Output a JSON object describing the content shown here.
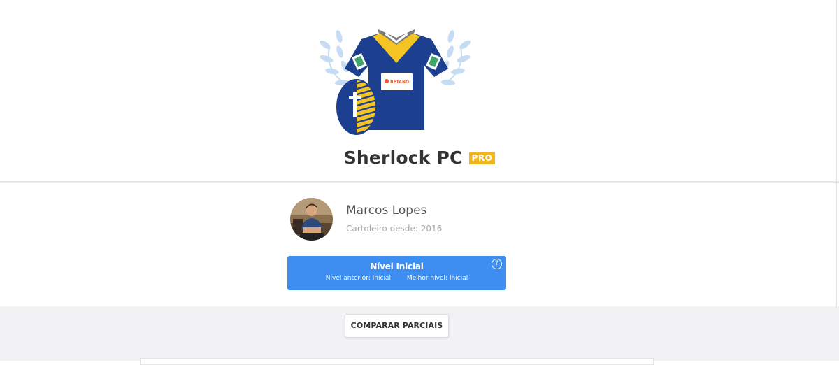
{
  "team": {
    "name": "Sherlock PC",
    "badge": "PRO",
    "sponsor_text": "BETANO"
  },
  "owner": {
    "name": "Marcos Lopes",
    "since": "Cartoleiro desde: 2016"
  },
  "level": {
    "title": "Nível Inicial",
    "previous": "Nível anterior: Inicial",
    "best": "Melhor nível: Inicial",
    "help": "?"
  },
  "actions": {
    "compare_label": "COMPARAR PARCIAIS"
  },
  "colors": {
    "shirt_blue": "#1c3f8f",
    "shirt_yellow": "#f4c425",
    "pro_badge": "#f2b51b",
    "level_card": "#3d8ef0",
    "laurel": "#c6dcf3",
    "sleeve_stripe": "#3fa56b"
  }
}
